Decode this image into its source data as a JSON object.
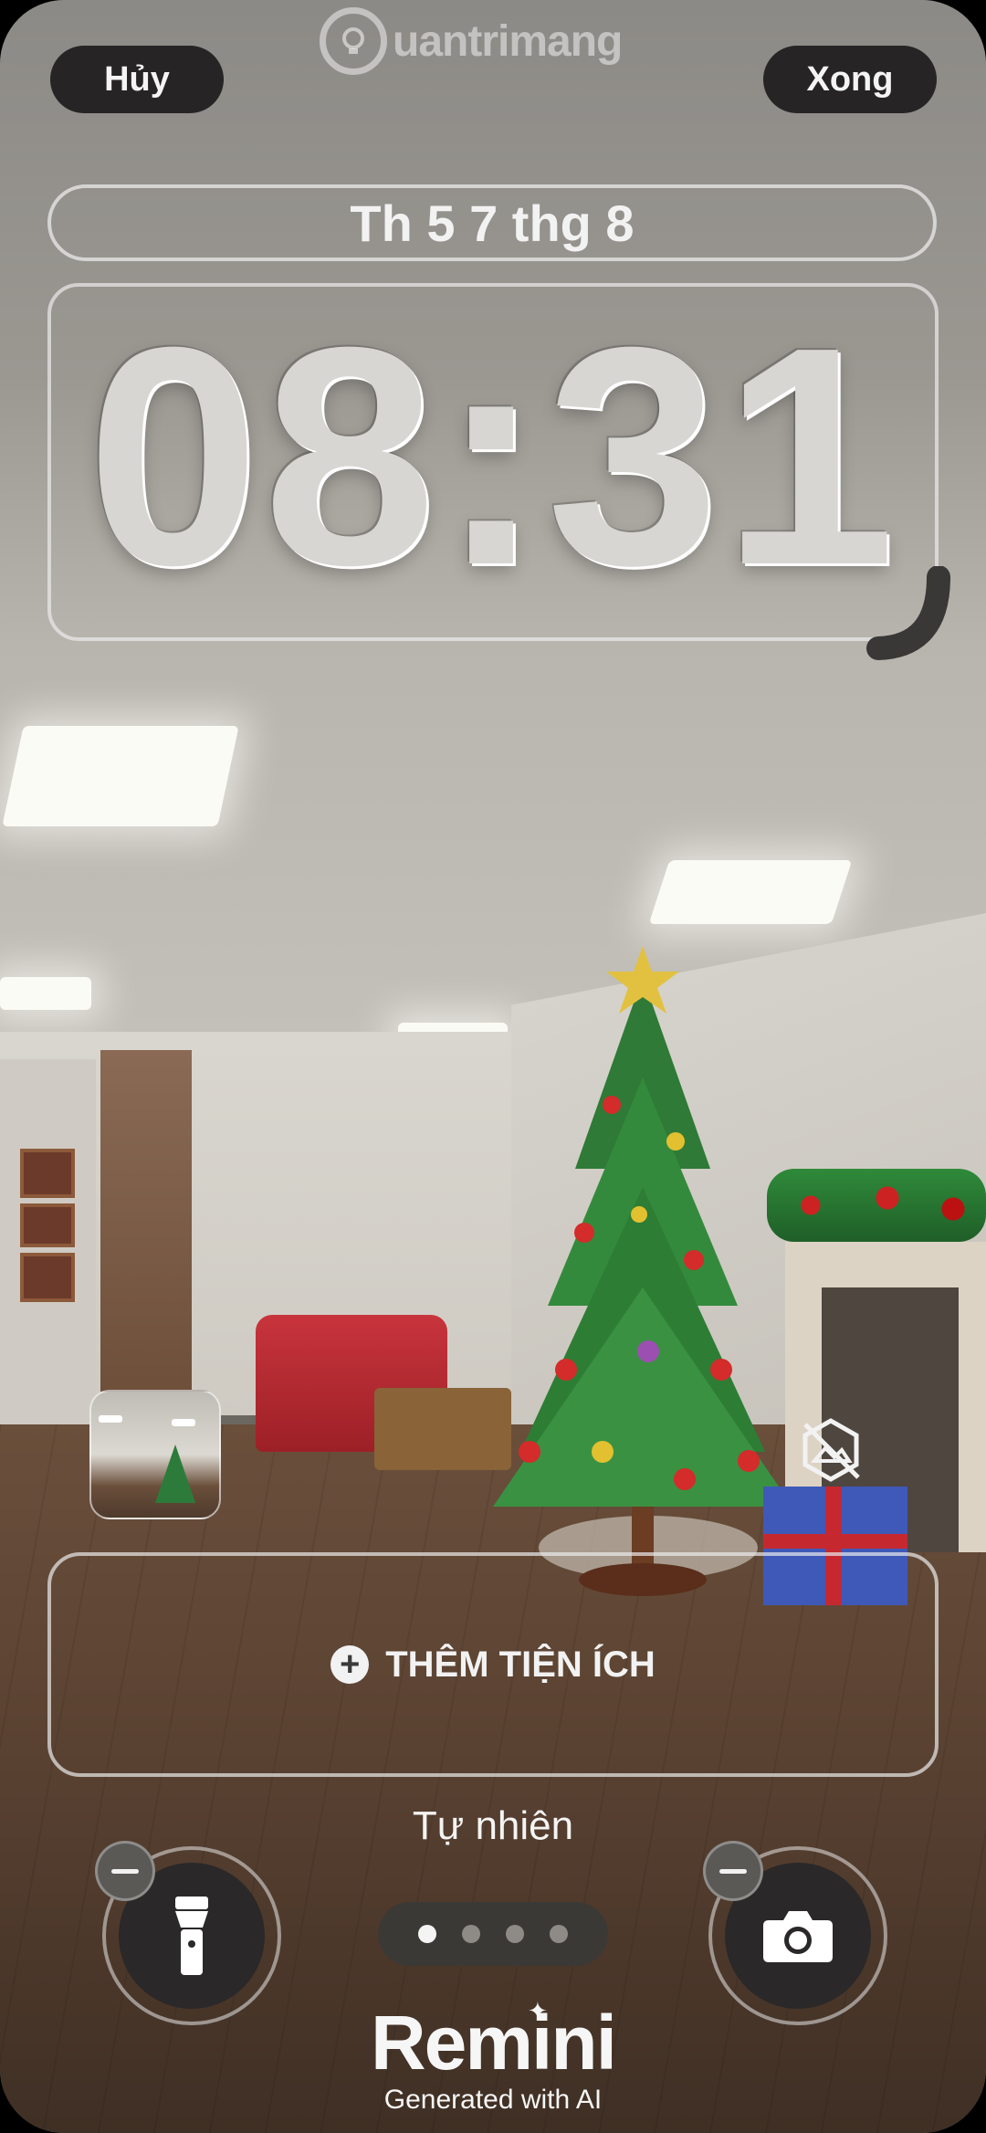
{
  "header": {
    "cancel_label": "Hủy",
    "done_label": "Xong",
    "watermark": "uantrimang"
  },
  "lockscreen": {
    "date": "Th 5 7 thg 8",
    "time": "08:31"
  },
  "widgets": {
    "add_label": "THÊM TIỆN ÍCH",
    "add_icon": "plus-circle-icon"
  },
  "style": {
    "name": "Tự nhiên",
    "page_count": 4,
    "active_page": 1
  },
  "quick_actions": {
    "left_icon": "flashlight-icon",
    "right_icon": "camera-icon"
  },
  "branding": {
    "title": "Remini",
    "subtitle": "Generated with AI"
  }
}
